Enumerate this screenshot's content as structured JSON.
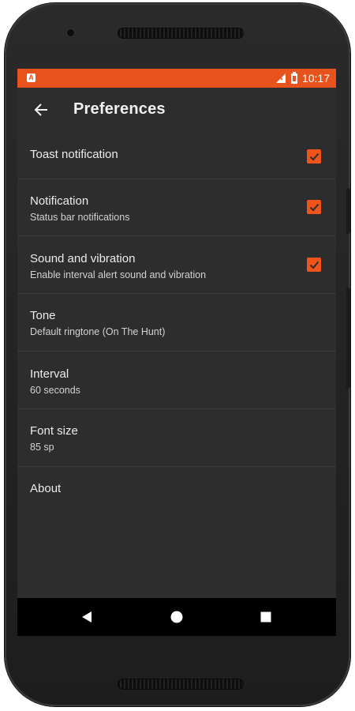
{
  "status_bar": {
    "time": "10:17",
    "app_icon_letter": "A",
    "background_color": "#e8521c"
  },
  "toolbar": {
    "title": "Preferences",
    "back_icon": "arrow-left-icon"
  },
  "preferences": [
    {
      "title": "Toast notification",
      "summary": "",
      "checked": true
    },
    {
      "title": "Notification",
      "summary": "Status bar notifications",
      "checked": true
    },
    {
      "title": "Sound and vibration",
      "summary": "Enable interval alert sound and vibration",
      "checked": true
    },
    {
      "title": "Tone",
      "summary": "Default ringtone (On The Hunt)"
    },
    {
      "title": "Interval",
      "summary": "60 seconds"
    },
    {
      "title": "Font size",
      "summary": "85 sp"
    },
    {
      "title": "About",
      "summary": ""
    }
  ],
  "navigation_bar": {
    "back_icon": "triangle-back-icon",
    "home_icon": "circle-home-icon",
    "recents_icon": "square-recents-icon"
  },
  "colors": {
    "accent": "#f0541c",
    "background": "#2d2d2d",
    "divider": "#3c3c3c"
  }
}
